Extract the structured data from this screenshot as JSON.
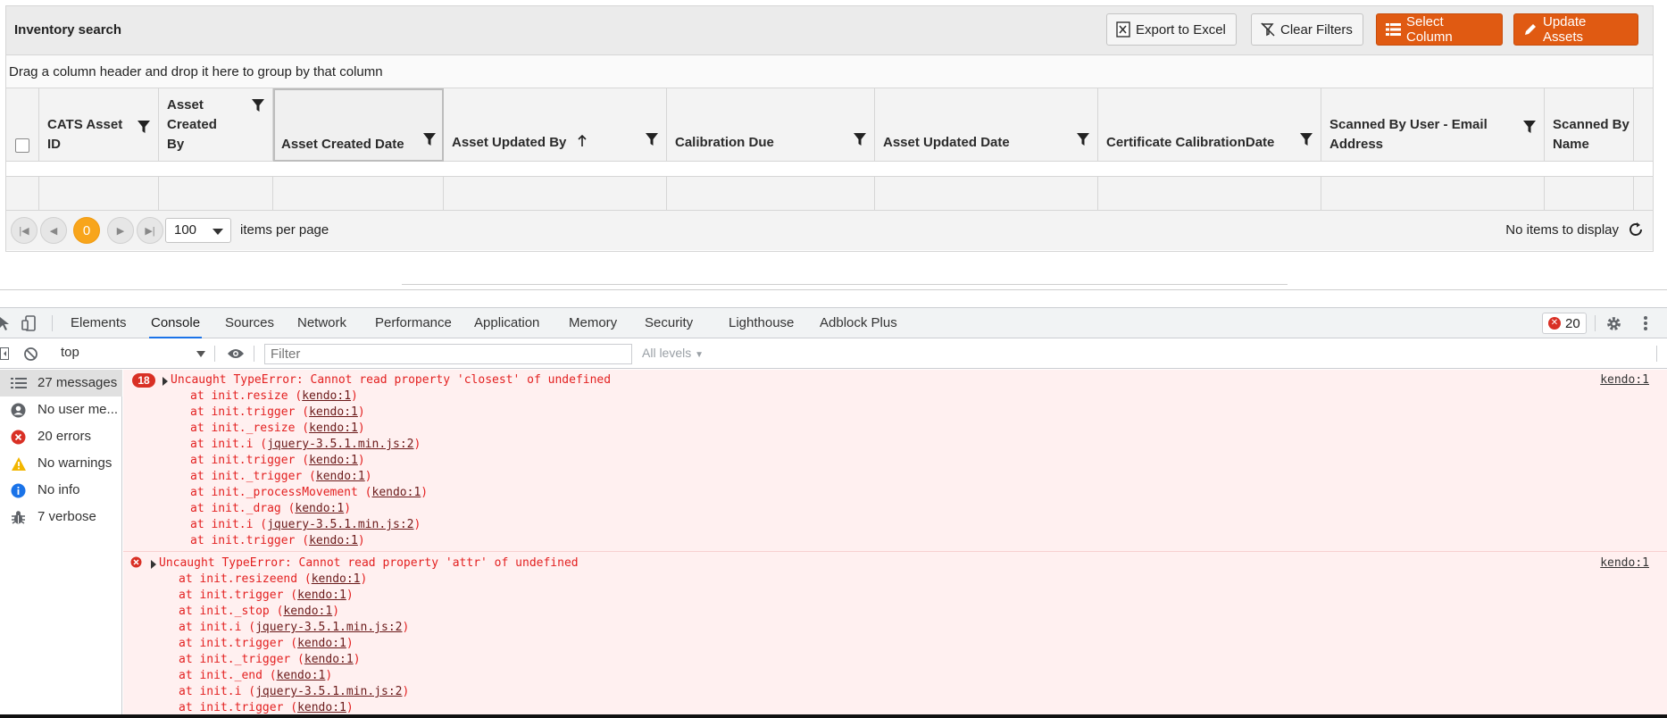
{
  "grid": {
    "title": "Inventory search",
    "buttons": {
      "export": "Export to Excel",
      "clear": "Clear Filters",
      "select_column": "Select Column",
      "update_assets": "Update Assets"
    },
    "group_hint": "Drag a column header and drop it here to group by that column",
    "columns": [
      {
        "label": "CATS Asset ID"
      },
      {
        "label": "Asset Created By"
      },
      {
        "label": "Asset Created Date"
      },
      {
        "label": "Asset Updated By"
      },
      {
        "label": "Calibration Due"
      },
      {
        "label": "Asset Updated Date"
      },
      {
        "label": "Certificate CalibrationDate"
      },
      {
        "label": "Scanned By User - Email Address"
      },
      {
        "label": "Scanned By Name"
      }
    ],
    "pager": {
      "current_page": "0",
      "page_size": "100",
      "items_per_page": "items per page",
      "no_items": "No items to display"
    }
  },
  "devtools": {
    "tabs": [
      "Elements",
      "Console",
      "Sources",
      "Network",
      "Performance",
      "Application",
      "Memory",
      "Security",
      "Lighthouse",
      "Adblock Plus"
    ],
    "active_tab": "Console",
    "error_count": "20",
    "context": "top",
    "filter_placeholder": "Filter",
    "levels": "All levels",
    "sidebar": [
      {
        "label": "27 messages",
        "icon": "list-icon"
      },
      {
        "label": "No user me...",
        "icon": "user-icon"
      },
      {
        "label": "20 errors",
        "icon": "error-icon"
      },
      {
        "label": "No warnings",
        "icon": "warning-icon"
      },
      {
        "label": "No info",
        "icon": "info-icon"
      },
      {
        "label": "7 verbose",
        "icon": "bug-icon"
      }
    ],
    "messages": [
      {
        "count": "18",
        "text": "Uncaught TypeError: Cannot read property 'closest' of undefined",
        "source": "kendo:1",
        "stack": [
          {
            "fn": "at init.resize",
            "loc": "kendo:1"
          },
          {
            "fn": "at init.trigger",
            "loc": "kendo:1"
          },
          {
            "fn": "at init._resize",
            "loc": "kendo:1"
          },
          {
            "fn": "at init.i",
            "loc": "jquery-3.5.1.min.js:2"
          },
          {
            "fn": "at init.trigger",
            "loc": "kendo:1"
          },
          {
            "fn": "at init._trigger",
            "loc": "kendo:1"
          },
          {
            "fn": "at init._processMovement",
            "loc": "kendo:1"
          },
          {
            "fn": "at init._drag",
            "loc": "kendo:1"
          },
          {
            "fn": "at init.i",
            "loc": "jquery-3.5.1.min.js:2"
          },
          {
            "fn": "at init.trigger",
            "loc": "kendo:1"
          }
        ]
      },
      {
        "count": "",
        "text": "Uncaught TypeError: Cannot read property 'attr' of undefined",
        "source": "kendo:1",
        "stack": [
          {
            "fn": "at init.resizeend",
            "loc": "kendo:1"
          },
          {
            "fn": "at init.trigger",
            "loc": "kendo:1"
          },
          {
            "fn": "at init._stop",
            "loc": "kendo:1"
          },
          {
            "fn": "at init.i",
            "loc": "jquery-3.5.1.min.js:2"
          },
          {
            "fn": "at init.trigger",
            "loc": "kendo:1"
          },
          {
            "fn": "at init._trigger",
            "loc": "kendo:1"
          },
          {
            "fn": "at init._end",
            "loc": "kendo:1"
          },
          {
            "fn": "at init.i",
            "loc": "jquery-3.5.1.min.js:2"
          },
          {
            "fn": "at init.trigger",
            "loc": "kendo:1"
          }
        ]
      }
    ]
  },
  "colors": {
    "accent_orange": "#e05a12",
    "pager_current": "#f8a51b",
    "error_red": "#e32020",
    "console_error_bg": "#fff0f0",
    "tab_underline": "#1a73e8"
  }
}
